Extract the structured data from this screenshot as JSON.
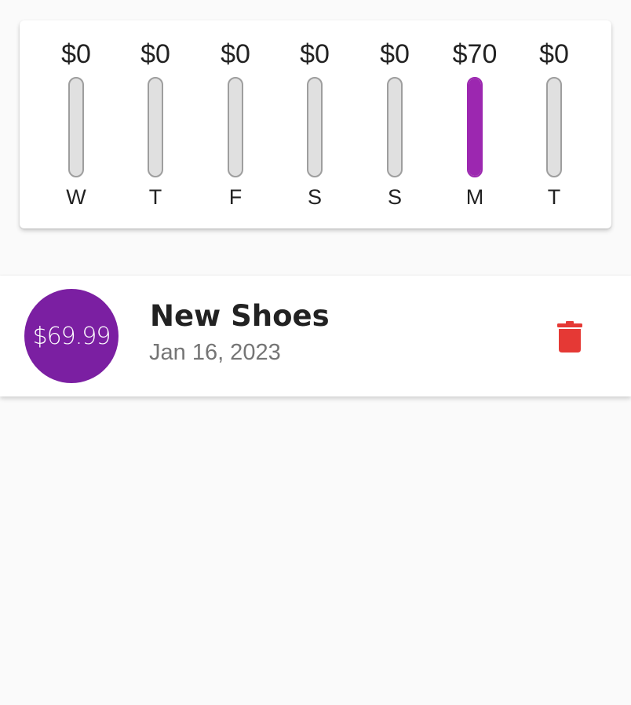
{
  "weekly_chart": {
    "days": [
      {
        "day": "W",
        "amount": "$0",
        "fraction": 0
      },
      {
        "day": "T",
        "amount": "$0",
        "fraction": 0
      },
      {
        "day": "F",
        "amount": "$0",
        "fraction": 0
      },
      {
        "day": "S",
        "amount": "$0",
        "fraction": 0
      },
      {
        "day": "S",
        "amount": "$0",
        "fraction": 0
      },
      {
        "day": "M",
        "amount": "$70",
        "fraction": 1
      },
      {
        "day": "T",
        "amount": "$0",
        "fraction": 0
      }
    ],
    "colors": {
      "fill": "#9c27b0",
      "track": "#e0e0e0",
      "track_border": "#9e9e9e"
    }
  },
  "transactions": [
    {
      "amount": "$69.99",
      "title": "New Shoes",
      "date": "Jan 16, 2023",
      "delete_icon": "trash-icon"
    }
  ],
  "colors": {
    "accent": "#7b1fa2",
    "delete": "#e53935",
    "background": "#fafafa"
  }
}
